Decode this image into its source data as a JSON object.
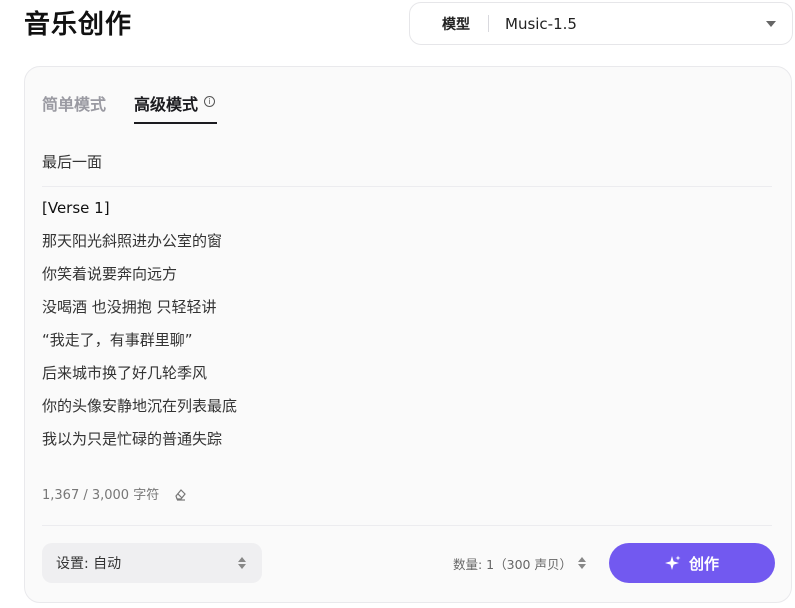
{
  "page": {
    "title": "音乐创作"
  },
  "model": {
    "label": "模型",
    "value": "Music-1.5"
  },
  "tabs": [
    {
      "label": "简单模式",
      "active": false
    },
    {
      "label": "高级模式",
      "active": true
    }
  ],
  "info_icon_glyph": "i",
  "song": {
    "title": "最后一面"
  },
  "lyrics": [
    "[Verse 1]",
    "那天阳光斜照进办公室的窗",
    "你笑着说要奔向远方",
    "没喝酒 也没拥抱 只轻轻讲",
    "“我走了，有事群里聊”",
    "后来城市换了好几轮季风",
    "你的头像安静地沉在列表最底",
    "我以为只是忙碌的普通失踪"
  ],
  "char_count": "1,367 / 3,000 字符",
  "settings": {
    "label": "设置: 自动"
  },
  "quantity": {
    "label": "数量: 1（300 声贝）"
  },
  "create_button": {
    "label": "创作"
  },
  "colors": {
    "accent": "#7259f0",
    "panel_bg": "#fafafa"
  }
}
